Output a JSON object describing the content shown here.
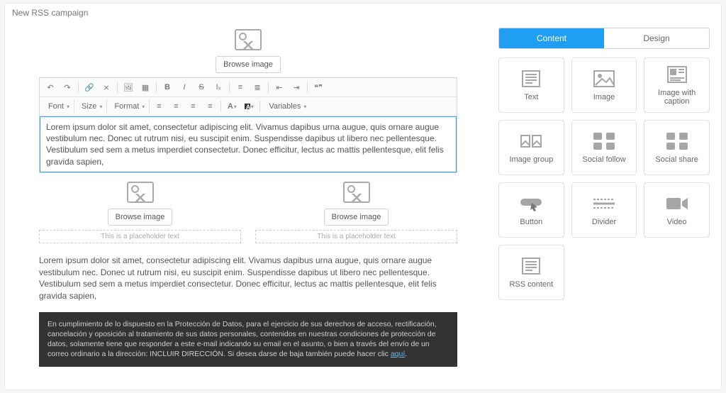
{
  "header": {
    "title": "New RSS campaign"
  },
  "toolbar": {
    "bold": "B",
    "italic": "I",
    "strike": "S",
    "clear": "Iₓ",
    "font": "Font",
    "size": "Size",
    "format": "Format",
    "variables": "Variables"
  },
  "canvas": {
    "browse_image_label": "Browse image",
    "caption_placeholder": "This is a placeholder text",
    "editor_text": "Lorem ipsum dolor sit amet, consectetur adipiscing elit. Vivamus dapibus urna augue, quis ornare augue vestibulum nec. Donec ut rutrum nisi, eu suscipit enim. Suspendisse dapibus ut libero nec pellentesque. Vestibulum sed sem a metus imperdiet consectetur. Donec efficitur, lectus ac mattis pellentesque, elit felis gravida sapien,",
    "body_text": "Lorem ipsum dolor sit amet, consectetur adipiscing elit. Vivamus dapibus urna augue, quis ornare augue vestibulum nec. Donec ut rutrum nisi, eu suscipit enim. Suspendisse dapibus ut libero nec pellentesque. Vestibulum sed sem a metus imperdiet consectetur. Donec efficitur, lectus ac mattis pellentesque, elit felis gravida sapien,",
    "footer_text": "En cumplimiento de lo dispuesto en la Protección de Datos, para el ejercicio de sus derechos de acceso, rectificación, cancelación y oposición al tratamiento de sus datos personales, contenidos en nuestras condiciones de protección de datos, solamente tiene que responder a este e-mail indicando su email en el asunto, o bien a través del envío de un correo ordinario a la dirección: INCLUIR DIRECCIÓN. Si desea darse de baja también puede hacer clic ",
    "footer_link": "aquí"
  },
  "panel": {
    "tabs": [
      "Content",
      "Design"
    ],
    "active_tab": 0,
    "blocks": [
      {
        "id": "text",
        "label": "Text"
      },
      {
        "id": "image",
        "label": "Image"
      },
      {
        "id": "image_caption",
        "label": "Image with caption"
      },
      {
        "id": "image_group",
        "label": "Image group"
      },
      {
        "id": "social_follow",
        "label": "Social follow"
      },
      {
        "id": "social_share",
        "label": "Social share"
      },
      {
        "id": "button",
        "label": "Button"
      },
      {
        "id": "divider",
        "label": "Divider"
      },
      {
        "id": "video",
        "label": "Video"
      },
      {
        "id": "rss_content",
        "label": "RSS content"
      }
    ]
  }
}
